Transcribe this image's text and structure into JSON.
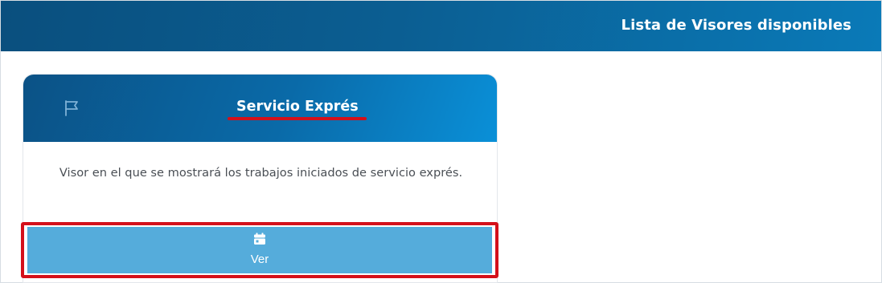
{
  "header": {
    "title": "Lista de Visores disponibles"
  },
  "card": {
    "icon": "flag-icon",
    "title": "Servicio Exprés",
    "description": "Visor en el que se mostrará los trabajos iniciados de servicio exprés.",
    "button": {
      "icon": "calendar-icon",
      "label": "Ver"
    }
  },
  "colors": {
    "header_gradient_start": "#0a4f7e",
    "header_gradient_end": "#0a7ab8",
    "card_header_end": "#0a90d8",
    "button_bg": "#55acdb",
    "highlight_red": "#d4101a",
    "text_dark": "#4a4f55"
  }
}
